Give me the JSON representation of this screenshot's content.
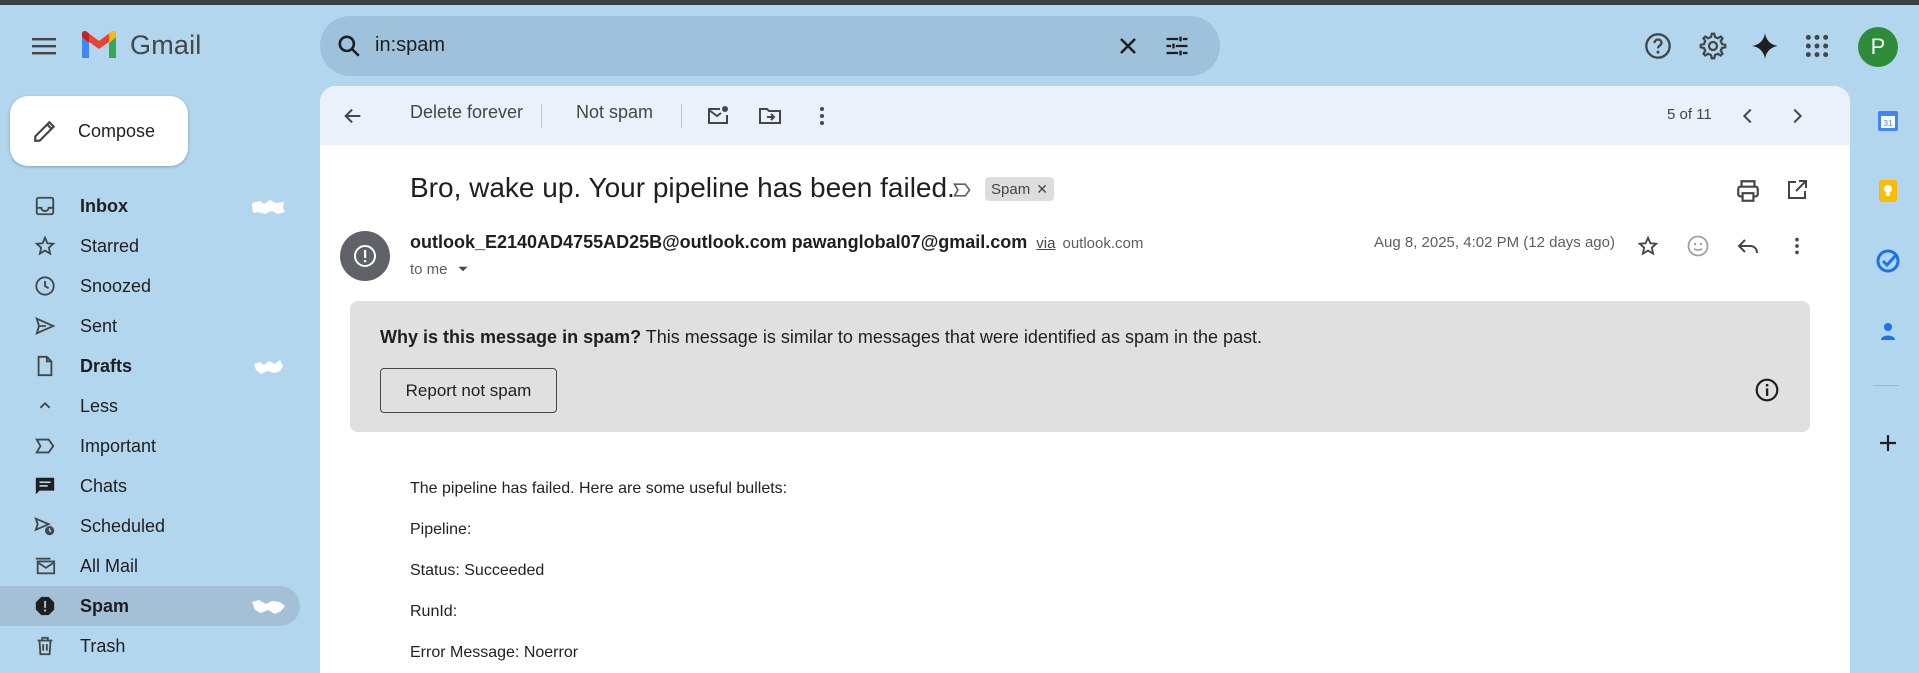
{
  "app": {
    "name": "Gmail"
  },
  "search": {
    "query": "in:spam"
  },
  "account": {
    "avatar_letter": "P",
    "avatar_color": "#2e8b3a"
  },
  "compose": {
    "label": "Compose"
  },
  "sidebar": {
    "items": [
      {
        "label": "Inbox",
        "icon": "inbox-icon",
        "bold": true
      },
      {
        "label": "Starred",
        "icon": "star-icon"
      },
      {
        "label": "Snoozed",
        "icon": "clock-icon"
      },
      {
        "label": "Sent",
        "icon": "send-icon"
      },
      {
        "label": "Drafts",
        "icon": "draft-icon",
        "bold": true
      },
      {
        "label": "Less",
        "icon": "chevron-up-icon"
      },
      {
        "label": "Important",
        "icon": "important-icon"
      },
      {
        "label": "Chats",
        "icon": "chat-icon"
      },
      {
        "label": "Scheduled",
        "icon": "scheduled-icon"
      },
      {
        "label": "All Mail",
        "icon": "all-mail-icon"
      },
      {
        "label": "Spam",
        "icon": "spam-icon",
        "bold": true,
        "active": true
      },
      {
        "label": "Trash",
        "icon": "trash-icon"
      }
    ]
  },
  "toolbar": {
    "delete_forever": "Delete forever",
    "not_spam": "Not spam",
    "pager": "5 of 11"
  },
  "message": {
    "subject": "Bro, wake up. Your pipeline has been failed.",
    "label_chip": "Spam",
    "sender_name": "outlook_E2140AD4755AD25B@outlook.com pawanglobal07@gmail.com",
    "via": "via",
    "via_domain": "outlook.com",
    "to": "to me",
    "date": "Aug 8, 2025, 4:02 PM (12 days ago)",
    "spam_reason_title": "Why is this message in spam?",
    "spam_reason_text": "This message is similar to messages that were identified as spam in the past.",
    "report_not_spam": "Report not spam",
    "body": [
      "The pipeline has failed. Here are some useful bullets:",
      "Pipeline:",
      "Status: Succeeded",
      "RunId:",
      "Error Message: Noerror"
    ]
  },
  "colors": {
    "background": "#b2d6ee",
    "search": "#9ec2db",
    "toolbar": "#eaf1fb",
    "active_nav": "#a3c0d6",
    "spam_box": "#e0e0e0"
  }
}
